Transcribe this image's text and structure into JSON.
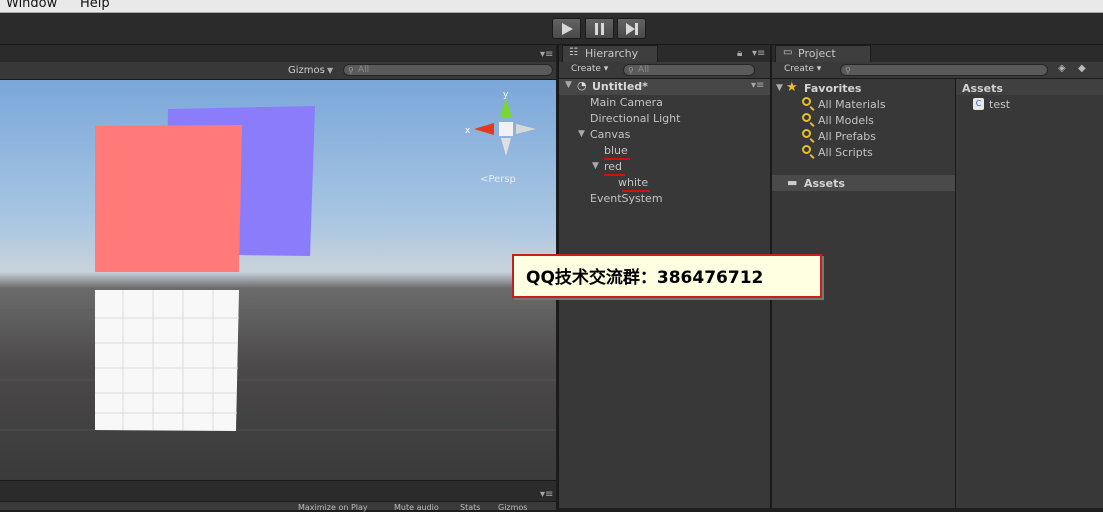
{
  "menu": {
    "items": [
      "Window",
      "Help"
    ]
  },
  "scene": {
    "gizmos_label": "Gizmos",
    "search_placeholder": "All",
    "persp_label": "Persp",
    "axis": {
      "x": "x",
      "y": "y"
    }
  },
  "hierarchy": {
    "tab_label": "Hierarchy",
    "create_label": "Create",
    "search_placeholder": "All",
    "scene_name": "Untitled*",
    "items": [
      "Main Camera",
      "Directional Light",
      "Canvas",
      "blue",
      "red",
      "white",
      "EventSystem"
    ]
  },
  "project": {
    "tab_label": "Project",
    "create_label": "Create",
    "favorites_label": "Favorites",
    "favorites": [
      "All Materials",
      "All Models",
      "All Prefabs",
      "All Scripts"
    ],
    "assets_folder": "Assets",
    "assets_header": "Assets",
    "asset_files": [
      "test"
    ]
  },
  "bottom_tabs": [
    "Maximize on Play",
    "Mute audio",
    "Stats",
    "Gizmos"
  ],
  "callout": {
    "text": "QQ技术交流群：386476712"
  },
  "colors": {
    "red_panel": "#ff7a78",
    "blue_panel": "#8a7cfa",
    "white_panel": "#ffffff",
    "underline": "#d01010",
    "callout_bg": "#ffffe1",
    "callout_border": "#c81e1e"
  }
}
